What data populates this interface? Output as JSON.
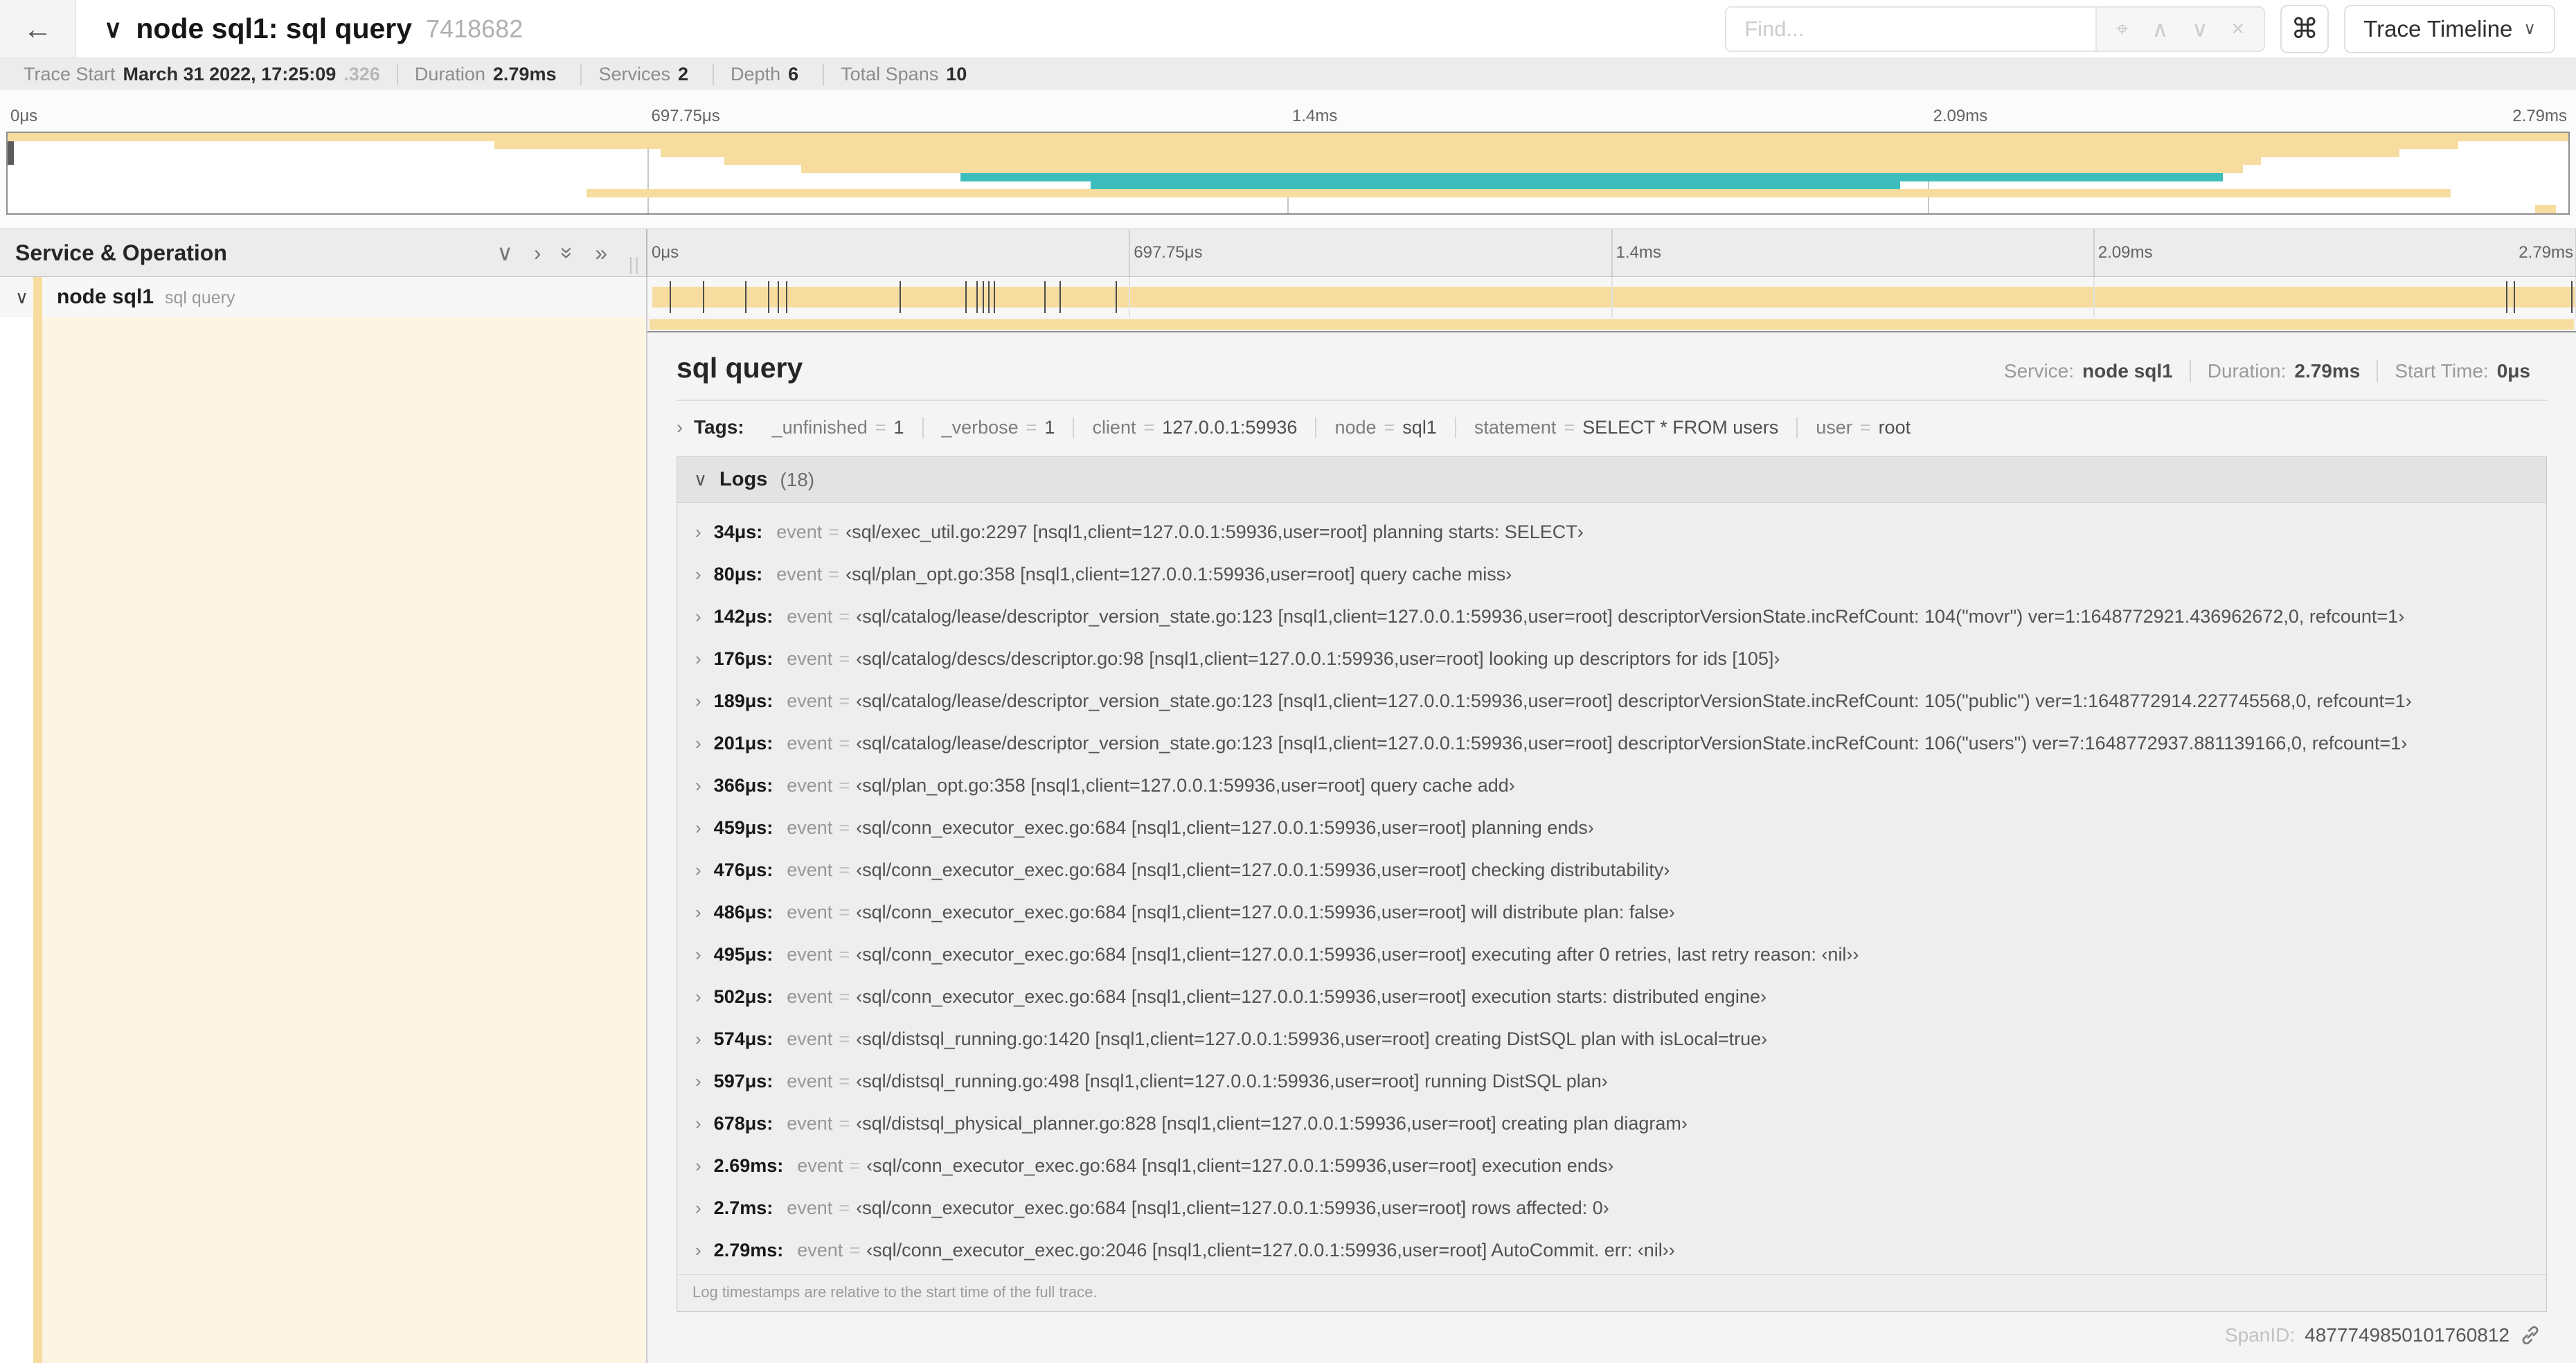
{
  "colors": {
    "span_tan": "#f7dca0",
    "span_teal": "#3dbdbd",
    "accent_cream": "#fdf5e4"
  },
  "header": {
    "back_icon": "←",
    "collapse_icon": "∨",
    "title": "node sql1: sql query",
    "trace_id": "7418682",
    "find_placeholder": "Find...",
    "shortcut_label": "⌘",
    "view_selector_label": "Trace Timeline",
    "view_selector_caret": "∨"
  },
  "trace_info": {
    "items": [
      {
        "label": "Trace Start",
        "value": "March 31 2022, 17:25:09",
        "suffix": ".326"
      },
      {
        "label": "Duration",
        "value": "2.79ms"
      },
      {
        "label": "Services",
        "value": "2"
      },
      {
        "label": "Depth",
        "value": "6"
      },
      {
        "label": "Total Spans",
        "value": "10"
      }
    ]
  },
  "minimap": {
    "rows": [
      {
        "row": 1,
        "start": 0,
        "end": 100,
        "color": "tan"
      },
      {
        "row": 2,
        "start": 19,
        "end": 95.7,
        "color": "tan"
      },
      {
        "row": 3,
        "start": 25.5,
        "end": 93.4,
        "color": "tan"
      },
      {
        "row": 4,
        "start": 28,
        "end": 88,
        "color": "tan"
      },
      {
        "row": 5,
        "start": 31,
        "end": 87.3,
        "color": "tan"
      },
      {
        "row": 6,
        "start": 37.2,
        "end": 86.5,
        "color": "teal"
      },
      {
        "row": 7,
        "start": 42.3,
        "end": 73.9,
        "color": "teal"
      },
      {
        "row": 8,
        "start": 22.6,
        "end": 95.4,
        "color": "tan"
      },
      {
        "row": 10,
        "start": 98.7,
        "end": 99.5,
        "color": "tan"
      }
    ]
  },
  "timeline": {
    "left_header": "Service & Operation",
    "collapse_icons": [
      "∨",
      "›",
      "»",
      "»"
    ],
    "grip": "||",
    "ticks": [
      {
        "label": "0μs",
        "pos": 0
      },
      {
        "label": "697.75μs",
        "pos": 25
      },
      {
        "label": "1.4ms",
        "pos": 50
      },
      {
        "label": "2.09ms",
        "pos": 75
      },
      {
        "label": "2.79ms",
        "pos": 100
      }
    ],
    "row": {
      "caret": "∨",
      "service": "node sql1",
      "operation": "sql query"
    },
    "log_marker_percents": [
      1.2,
      2.9,
      5.1,
      6.3,
      6.8,
      7.2,
      13.1,
      16.5,
      17.1,
      17.4,
      17.7,
      18.0,
      20.6,
      21.4,
      24.3,
      96.4,
      96.8,
      99.8
    ]
  },
  "detail": {
    "title": "sql query",
    "meta": [
      {
        "label": "Service:",
        "value": "node sql1"
      },
      {
        "label": "Duration:",
        "value": "2.79ms"
      },
      {
        "label": "Start Time:",
        "value": "0μs"
      }
    ],
    "tags": {
      "caret": "›",
      "label": "Tags:",
      "eq": "=",
      "items": [
        {
          "key": "_unfinished",
          "value": "1"
        },
        {
          "key": "_verbose",
          "value": "1"
        },
        {
          "key": "client",
          "value": "127.0.0.1:59936"
        },
        {
          "key": "node",
          "value": "sql1"
        },
        {
          "key": "statement",
          "value": "SELECT * FROM users"
        },
        {
          "key": "user",
          "value": "root"
        }
      ]
    },
    "logs": {
      "caret": "∨",
      "label": "Logs",
      "count": "(18)",
      "row_caret": "›",
      "event_key": "event",
      "eq": "=",
      "entries": [
        {
          "time": "34μs:",
          "value": "‹sql/exec_util.go:2297 [nsql1,client=127.0.0.1:59936,user=root] planning starts: SELECT›"
        },
        {
          "time": "80μs:",
          "value": "‹sql/plan_opt.go:358 [nsql1,client=127.0.0.1:59936,user=root] query cache miss›"
        },
        {
          "time": "142μs:",
          "value": "‹sql/catalog/lease/descriptor_version_state.go:123 [nsql1,client=127.0.0.1:59936,user=root] descriptorVersionState.incRefCount: 104(\"movr\") ver=1:1648772921.436962672,0, refcount=1›"
        },
        {
          "time": "176μs:",
          "value": "‹sql/catalog/descs/descriptor.go:98 [nsql1,client=127.0.0.1:59936,user=root] looking up descriptors for ids [105]›"
        },
        {
          "time": "189μs:",
          "value": "‹sql/catalog/lease/descriptor_version_state.go:123 [nsql1,client=127.0.0.1:59936,user=root] descriptorVersionState.incRefCount: 105(\"public\") ver=1:1648772914.227745568,0, refcount=1›"
        },
        {
          "time": "201μs:",
          "value": "‹sql/catalog/lease/descriptor_version_state.go:123 [nsql1,client=127.0.0.1:59936,user=root] descriptorVersionState.incRefCount: 106(\"users\") ver=7:1648772937.881139166,0, refcount=1›"
        },
        {
          "time": "366μs:",
          "value": "‹sql/plan_opt.go:358 [nsql1,client=127.0.0.1:59936,user=root] query cache add›"
        },
        {
          "time": "459μs:",
          "value": "‹sql/conn_executor_exec.go:684 [nsql1,client=127.0.0.1:59936,user=root] planning ends›"
        },
        {
          "time": "476μs:",
          "value": "‹sql/conn_executor_exec.go:684 [nsql1,client=127.0.0.1:59936,user=root] checking distributability›"
        },
        {
          "time": "486μs:",
          "value": "‹sql/conn_executor_exec.go:684 [nsql1,client=127.0.0.1:59936,user=root] will distribute plan: false›"
        },
        {
          "time": "495μs:",
          "value": "‹sql/conn_executor_exec.go:684 [nsql1,client=127.0.0.1:59936,user=root] executing after 0 retries, last retry reason: ‹nil››"
        },
        {
          "time": "502μs:",
          "value": "‹sql/conn_executor_exec.go:684 [nsql1,client=127.0.0.1:59936,user=root] execution starts: distributed engine›"
        },
        {
          "time": "574μs:",
          "value": "‹sql/distsql_running.go:1420 [nsql1,client=127.0.0.1:59936,user=root] creating DistSQL plan with isLocal=true›"
        },
        {
          "time": "597μs:",
          "value": "‹sql/distsql_running.go:498 [nsql1,client=127.0.0.1:59936,user=root] running DistSQL plan›"
        },
        {
          "time": "678μs:",
          "value": "‹sql/distsql_physical_planner.go:828 [nsql1,client=127.0.0.1:59936,user=root] creating plan diagram›"
        },
        {
          "time": "2.69ms:",
          "value": "‹sql/conn_executor_exec.go:684 [nsql1,client=127.0.0.1:59936,user=root] execution ends›"
        },
        {
          "time": "2.7ms:",
          "value": "‹sql/conn_executor_exec.go:684 [nsql1,client=127.0.0.1:59936,user=root] rows affected: 0›"
        },
        {
          "time": "2.79ms:",
          "value": "‹sql/conn_executor_exec.go:2046 [nsql1,client=127.0.0.1:59936,user=root] AutoCommit. err: ‹nil››"
        }
      ],
      "footer": "Log timestamps are relative to the start time of the full trace."
    },
    "span_id_label": "SpanID:",
    "span_id": "4877749850101760812"
  }
}
